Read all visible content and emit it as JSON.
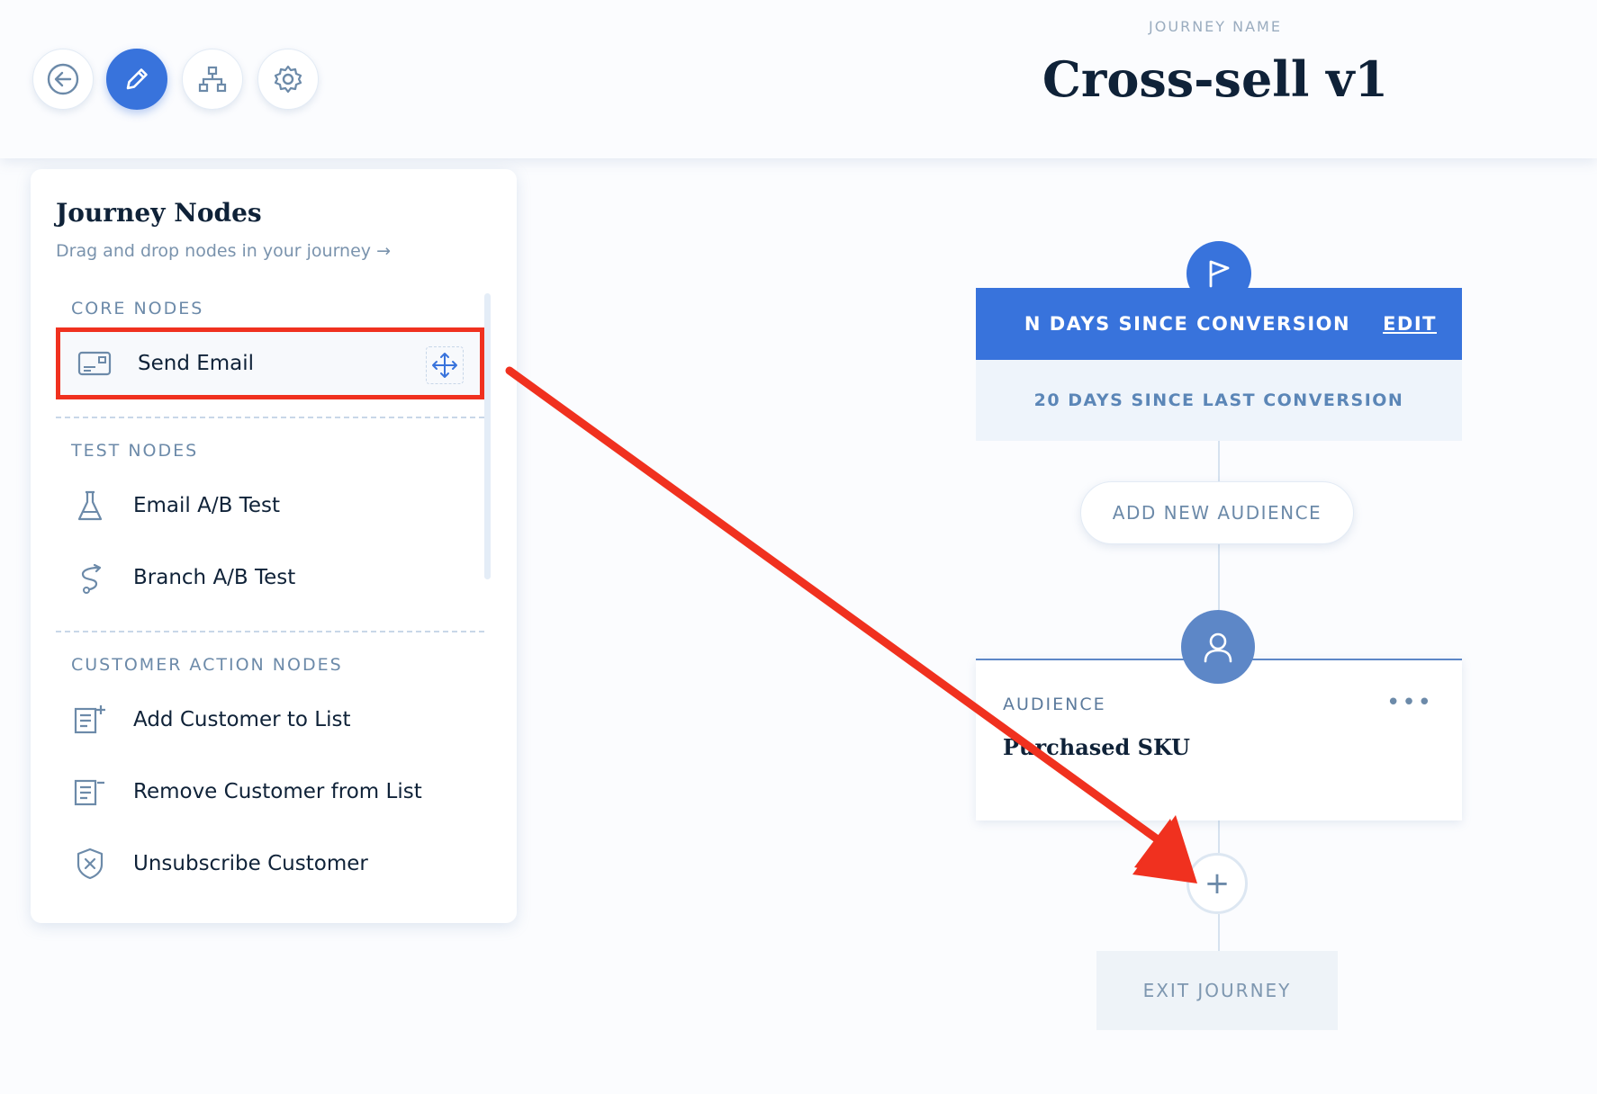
{
  "toolbar": {
    "back_icon": "back-arrow-icon",
    "edit_icon": "pencil-icon",
    "tree_icon": "sitemap-icon",
    "settings_icon": "gear-icon"
  },
  "header": {
    "label": "JOURNEY NAME",
    "title": "Cross-sell v1"
  },
  "panel": {
    "title": "Journey Nodes",
    "subtitle": "Drag and drop nodes in your journey →",
    "sections": {
      "core": "CORE NODES",
      "test": "TEST NODES",
      "customer": "CUSTOMER ACTION NODES"
    },
    "nodes": {
      "send_email": "Send Email",
      "email_ab": "Email A/B Test",
      "branch_ab": "Branch A/B Test",
      "add_list": "Add Customer to List",
      "remove_list": "Remove Customer from List",
      "unsubscribe": "Unsubscribe Customer"
    }
  },
  "canvas": {
    "trigger_title": "N DAYS SINCE CONVERSION",
    "trigger_edit": "EDIT",
    "trigger_detail": "20 DAYS SINCE LAST CONVERSION",
    "add_audience": "ADD NEW AUDIENCE",
    "audience_label": "AUDIENCE",
    "audience_name": "Purchased SKU",
    "audience_more": "•••",
    "add_step": "+",
    "exit": "EXIT JOURNEY"
  },
  "colors": {
    "accent": "#3873dc",
    "highlight": "#f0311f",
    "muted": "#6c8aa9"
  }
}
